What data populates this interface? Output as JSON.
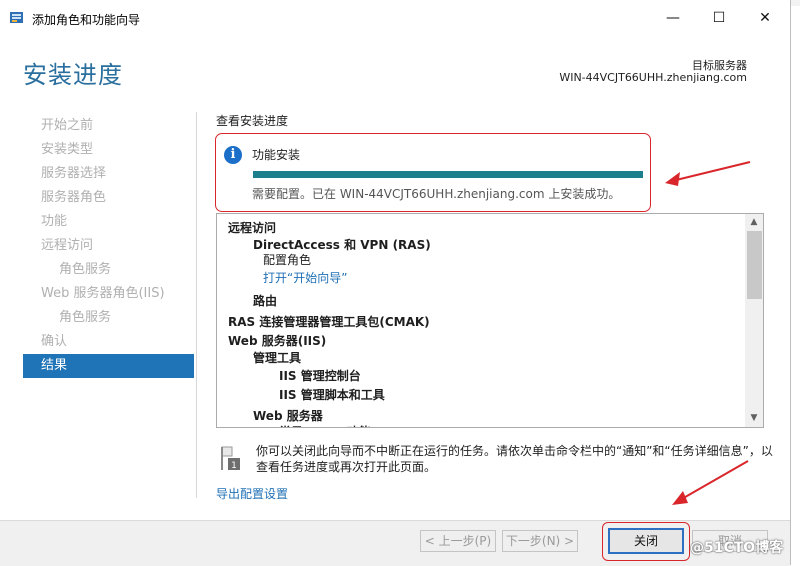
{
  "window": {
    "title": "添加角色和功能向导",
    "minimize_glyph": "—",
    "maximize_glyph": "☐",
    "close_glyph": "✕",
    "icon": "server-manager-icon"
  },
  "header": {
    "heading": "安装进度",
    "dest_label": "目标服务器",
    "dest_server": "WIN-44VCJT66UHH.zhenjiang.com"
  },
  "nav": {
    "items": [
      {
        "label": "开始之前",
        "sub": false,
        "active": false
      },
      {
        "label": "安装类型",
        "sub": false,
        "active": false
      },
      {
        "label": "服务器选择",
        "sub": false,
        "active": false
      },
      {
        "label": "服务器角色",
        "sub": false,
        "active": false
      },
      {
        "label": "功能",
        "sub": false,
        "active": false
      },
      {
        "label": "远程访问",
        "sub": false,
        "active": false
      },
      {
        "label": "角色服务",
        "sub": true,
        "active": false
      },
      {
        "label": "Web 服务器角色(IIS)",
        "sub": false,
        "active": false
      },
      {
        "label": "角色服务",
        "sub": true,
        "active": false
      },
      {
        "label": "确认",
        "sub": false,
        "active": false
      },
      {
        "label": "结果",
        "sub": false,
        "active": true
      }
    ]
  },
  "main": {
    "section_label": "查看安装进度",
    "feature_install": "功能安装",
    "progress": 1.0,
    "status": "需要配置。已在 WIN-44VCJT66UHH.zhenjiang.com 上安装成功。",
    "results": [
      {
        "text": "远程访问",
        "level": 0,
        "bold": true,
        "link": false
      },
      {
        "text": "DirectAccess 和 VPN (RAS)",
        "level": 1,
        "bold": true,
        "link": false
      },
      {
        "text": "配置角色",
        "level": 2,
        "bold": false,
        "link": false
      },
      {
        "text": "打开“开始向导”",
        "level": 2,
        "bold": false,
        "link": true
      },
      {
        "text": "路由",
        "level": 1,
        "bold": true,
        "link": false
      },
      {
        "text": "RAS 连接管理器管理工具包(CMAK)",
        "level": 0,
        "bold": true,
        "link": false
      },
      {
        "text": "Web 服务器(IIS)",
        "level": 0,
        "bold": true,
        "link": false
      },
      {
        "text": "管理工具",
        "level": 1,
        "bold": true,
        "link": false
      },
      {
        "text": "IIS 管理控制台",
        "level": 3,
        "bold": true,
        "link": false
      },
      {
        "text": "IIS 管理脚本和工具",
        "level": 3,
        "bold": true,
        "link": false
      },
      {
        "text": "Web 服务器",
        "level": 1,
        "bold": true,
        "link": false
      },
      {
        "text": "常见 HTTP 功能",
        "level": 3,
        "bold": true,
        "link": false
      }
    ],
    "notice": "你可以关闭此向导而不中断正在运行的任务。请依次单击命令栏中的“通知”和“任务详细信息”，以查看任务进度或再次打开此页面。",
    "export_link": "导出配置设置"
  },
  "footer": {
    "prev": "< 上一步(P)",
    "next": "下一步(N) >",
    "close": "关闭",
    "cancel": "取消"
  },
  "watermark": "@51CTO博客",
  "colors": {
    "accent": "#1f73b7",
    "heading": "#2a6f9e",
    "progress": "#1e7f8c",
    "annotation": "#d9262b",
    "link": "#1f6fb5"
  }
}
